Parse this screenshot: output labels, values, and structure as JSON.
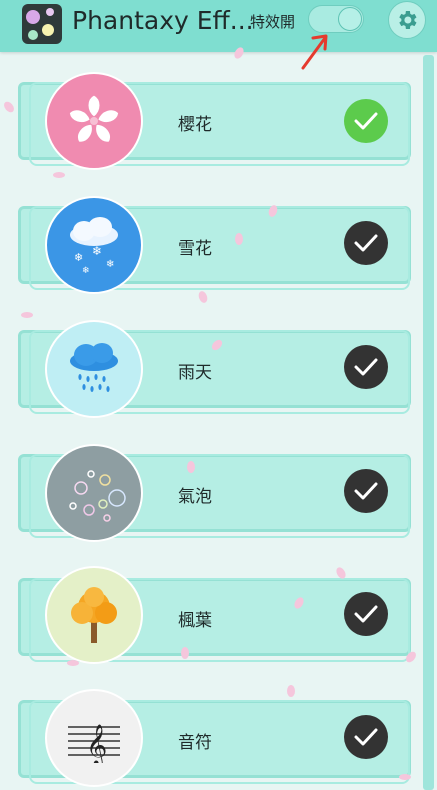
{
  "app": {
    "title": "Phantaxy Eff...",
    "toggle_label": "特效開",
    "toggle_on": true
  },
  "colors": {
    "topbar": "#7fded0",
    "row_bg": "#b5eee4",
    "check_selected": "#5ccb4c",
    "check_unselected": "#333333"
  },
  "effects": [
    {
      "label": "櫻花",
      "icon": "sakura-icon",
      "selected": true,
      "circle_color": "#f08bb0"
    },
    {
      "label": "雪花",
      "icon": "snow-cloud-icon",
      "selected": false,
      "circle_color": "#3b96e6"
    },
    {
      "label": "雨天",
      "icon": "rain-cloud-icon",
      "selected": false,
      "circle_color": "#bfeef4"
    },
    {
      "label": "氣泡",
      "icon": "bubbles-icon",
      "selected": false,
      "circle_color": "#8e9ea2"
    },
    {
      "label": "楓葉",
      "icon": "maple-tree-icon",
      "selected": false,
      "circle_color": "#e4f0c8"
    },
    {
      "label": "音符",
      "icon": "music-staff-icon",
      "selected": false,
      "circle_color": "#f1f1f1"
    }
  ]
}
